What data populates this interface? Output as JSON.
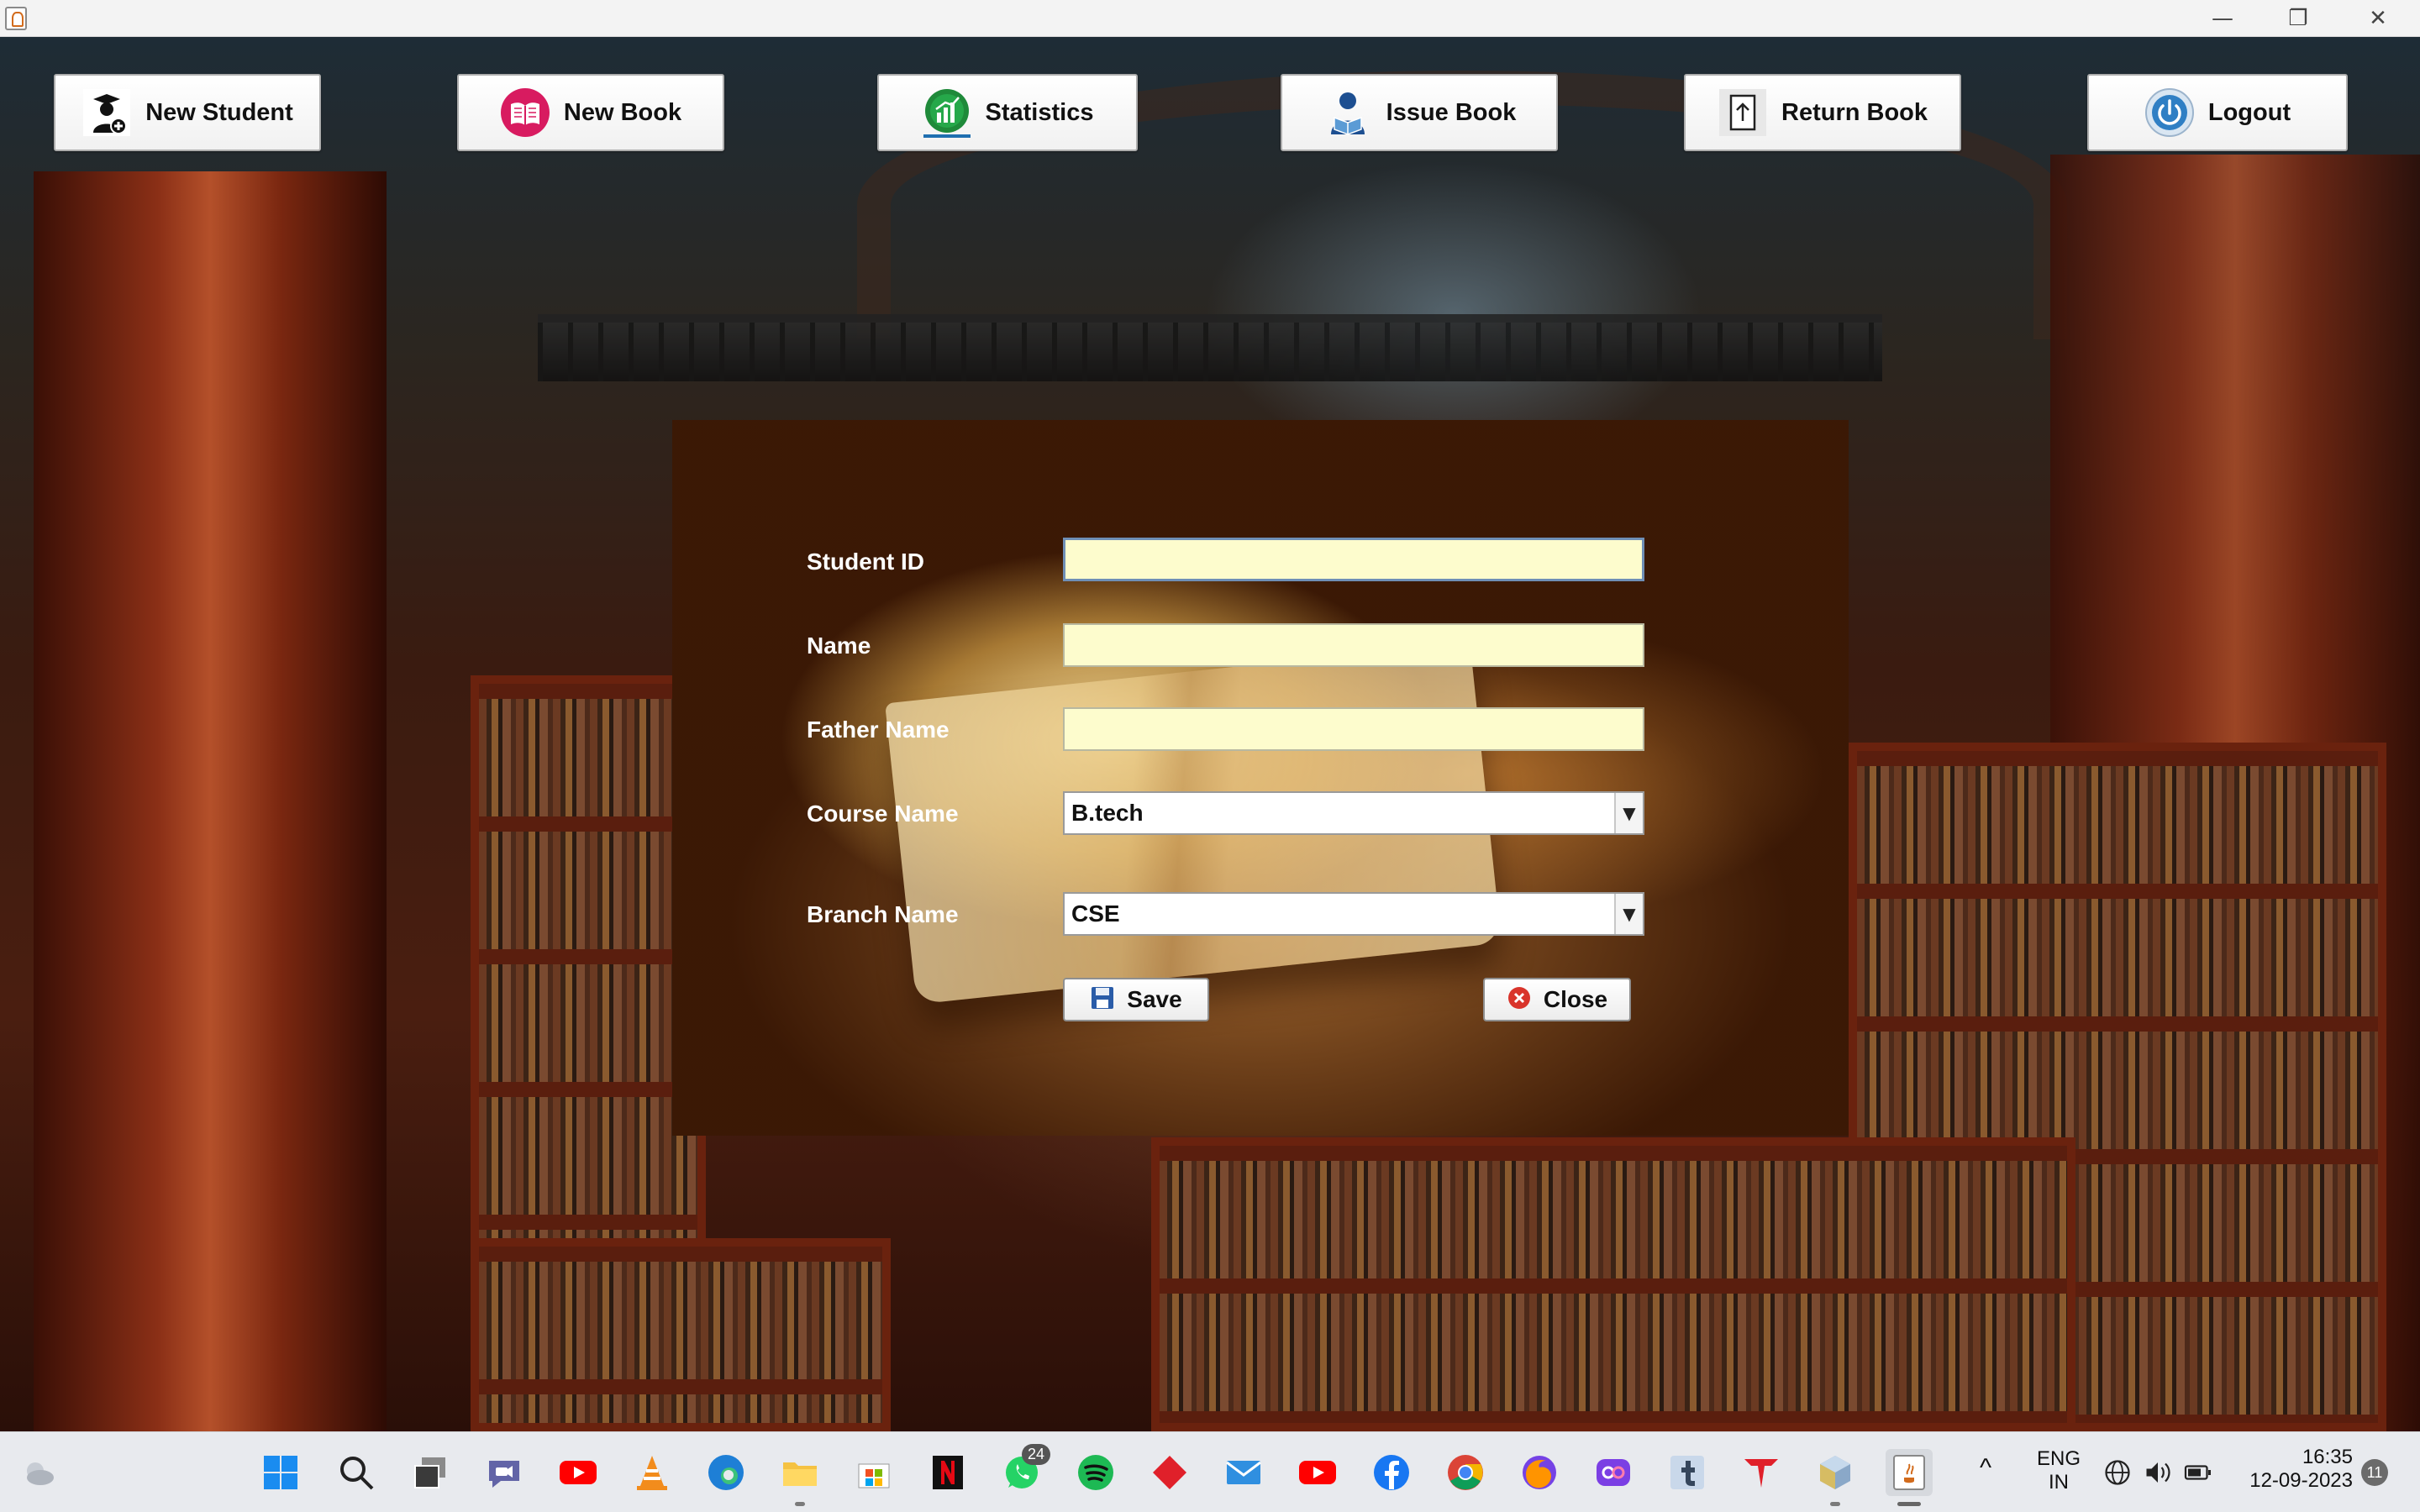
{
  "window": {
    "controls": {
      "minimize": "—",
      "maximize": "❐",
      "close": "✕"
    }
  },
  "toolbar": {
    "buttons": [
      {
        "label": "New Student",
        "icon": "student-add-icon"
      },
      {
        "label": "New Book",
        "icon": "book-icon"
      },
      {
        "label": "Statistics",
        "icon": "statistics-icon"
      },
      {
        "label": "Issue Book",
        "icon": "issue-book-icon"
      },
      {
        "label": "Return Book",
        "icon": "return-book-icon"
      },
      {
        "label": "Logout",
        "icon": "power-icon"
      }
    ]
  },
  "form": {
    "labels": {
      "student_id": "Student ID",
      "name": "Name",
      "father_name": "Father Name",
      "course_name": "Course Name",
      "branch_name": "Branch Name"
    },
    "values": {
      "student_id": "",
      "name": "",
      "father_name": "",
      "course_name": "B.tech",
      "branch_name": "CSE"
    },
    "buttons": {
      "save": "Save",
      "close": "Close"
    }
  },
  "taskbar": {
    "whatsapp_badge": "24",
    "language": {
      "line1": "ENG",
      "line2": "IN"
    },
    "time": "16:35",
    "date": "12-09-2023",
    "notification_count": "11",
    "colors": {
      "youtube": "#ff0000",
      "netflix": "#e50914",
      "spotify": "#1db954",
      "facebook": "#1877f2",
      "whatsapp": "#25d366"
    }
  }
}
